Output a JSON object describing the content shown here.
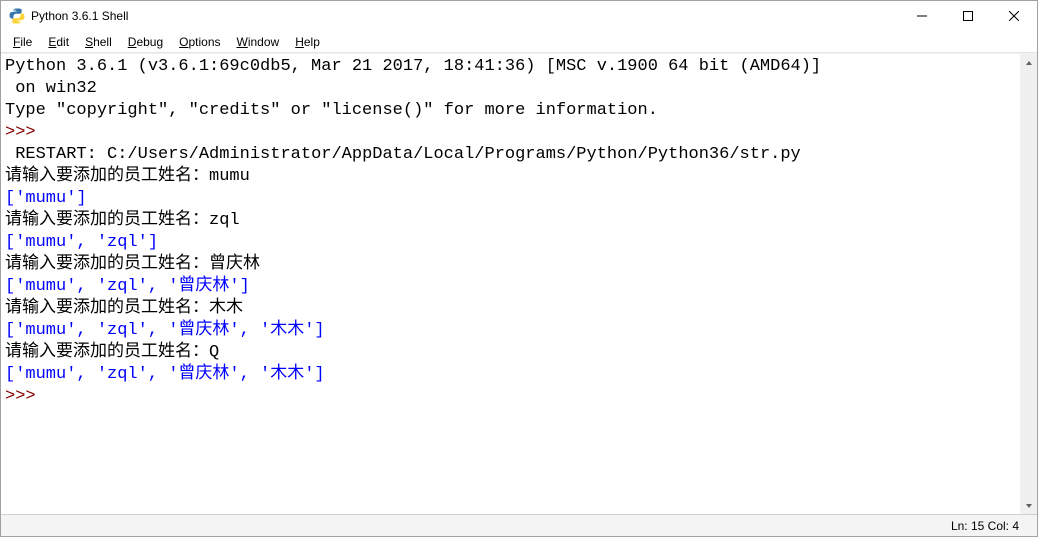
{
  "window": {
    "title": "Python 3.6.1 Shell"
  },
  "menu": {
    "file": {
      "pre": "",
      "u": "F",
      "post": "ile"
    },
    "edit": {
      "pre": "",
      "u": "E",
      "post": "dit"
    },
    "shell": {
      "pre": "",
      "u": "S",
      "post": "hell"
    },
    "debug": {
      "pre": "",
      "u": "D",
      "post": "ebug"
    },
    "options": {
      "pre": "",
      "u": "O",
      "post": "ptions"
    },
    "window": {
      "pre": "",
      "u": "W",
      "post": "indow"
    },
    "help": {
      "pre": "",
      "u": "H",
      "post": "elp"
    }
  },
  "shell": {
    "banner1": "Python 3.6.1 (v3.6.1:69c0db5, Mar 21 2017, 18:41:36) [MSC v.1900 64 bit (AMD64)]",
    "banner2": " on win32",
    "banner3": "Type \"copyright\", \"credits\" or \"license()\" for more information.",
    "prompt": ">>>",
    "restart_label": " RESTART: ",
    "restart_path": "C:/Users/Administrator/AppData/Local/Programs/Python/Python36/str.py ",
    "inp_label": "请输入要添加的员工姓名：",
    "inp1_val": "mumu",
    "out1": "['mumu']",
    "inp2_val": "zql",
    "out2": "['mumu', 'zql']",
    "inp3_val": "曾庆林",
    "out3": "['mumu', 'zql', '曾庆林']",
    "inp4_val": "木木",
    "out4": "['mumu', 'zql', '曾庆林', '木木']",
    "inp5_val": "Q",
    "out5": "['mumu', 'zql', '曾庆林', '木木']"
  },
  "status": {
    "text": "Ln: 15  Col: 4"
  }
}
